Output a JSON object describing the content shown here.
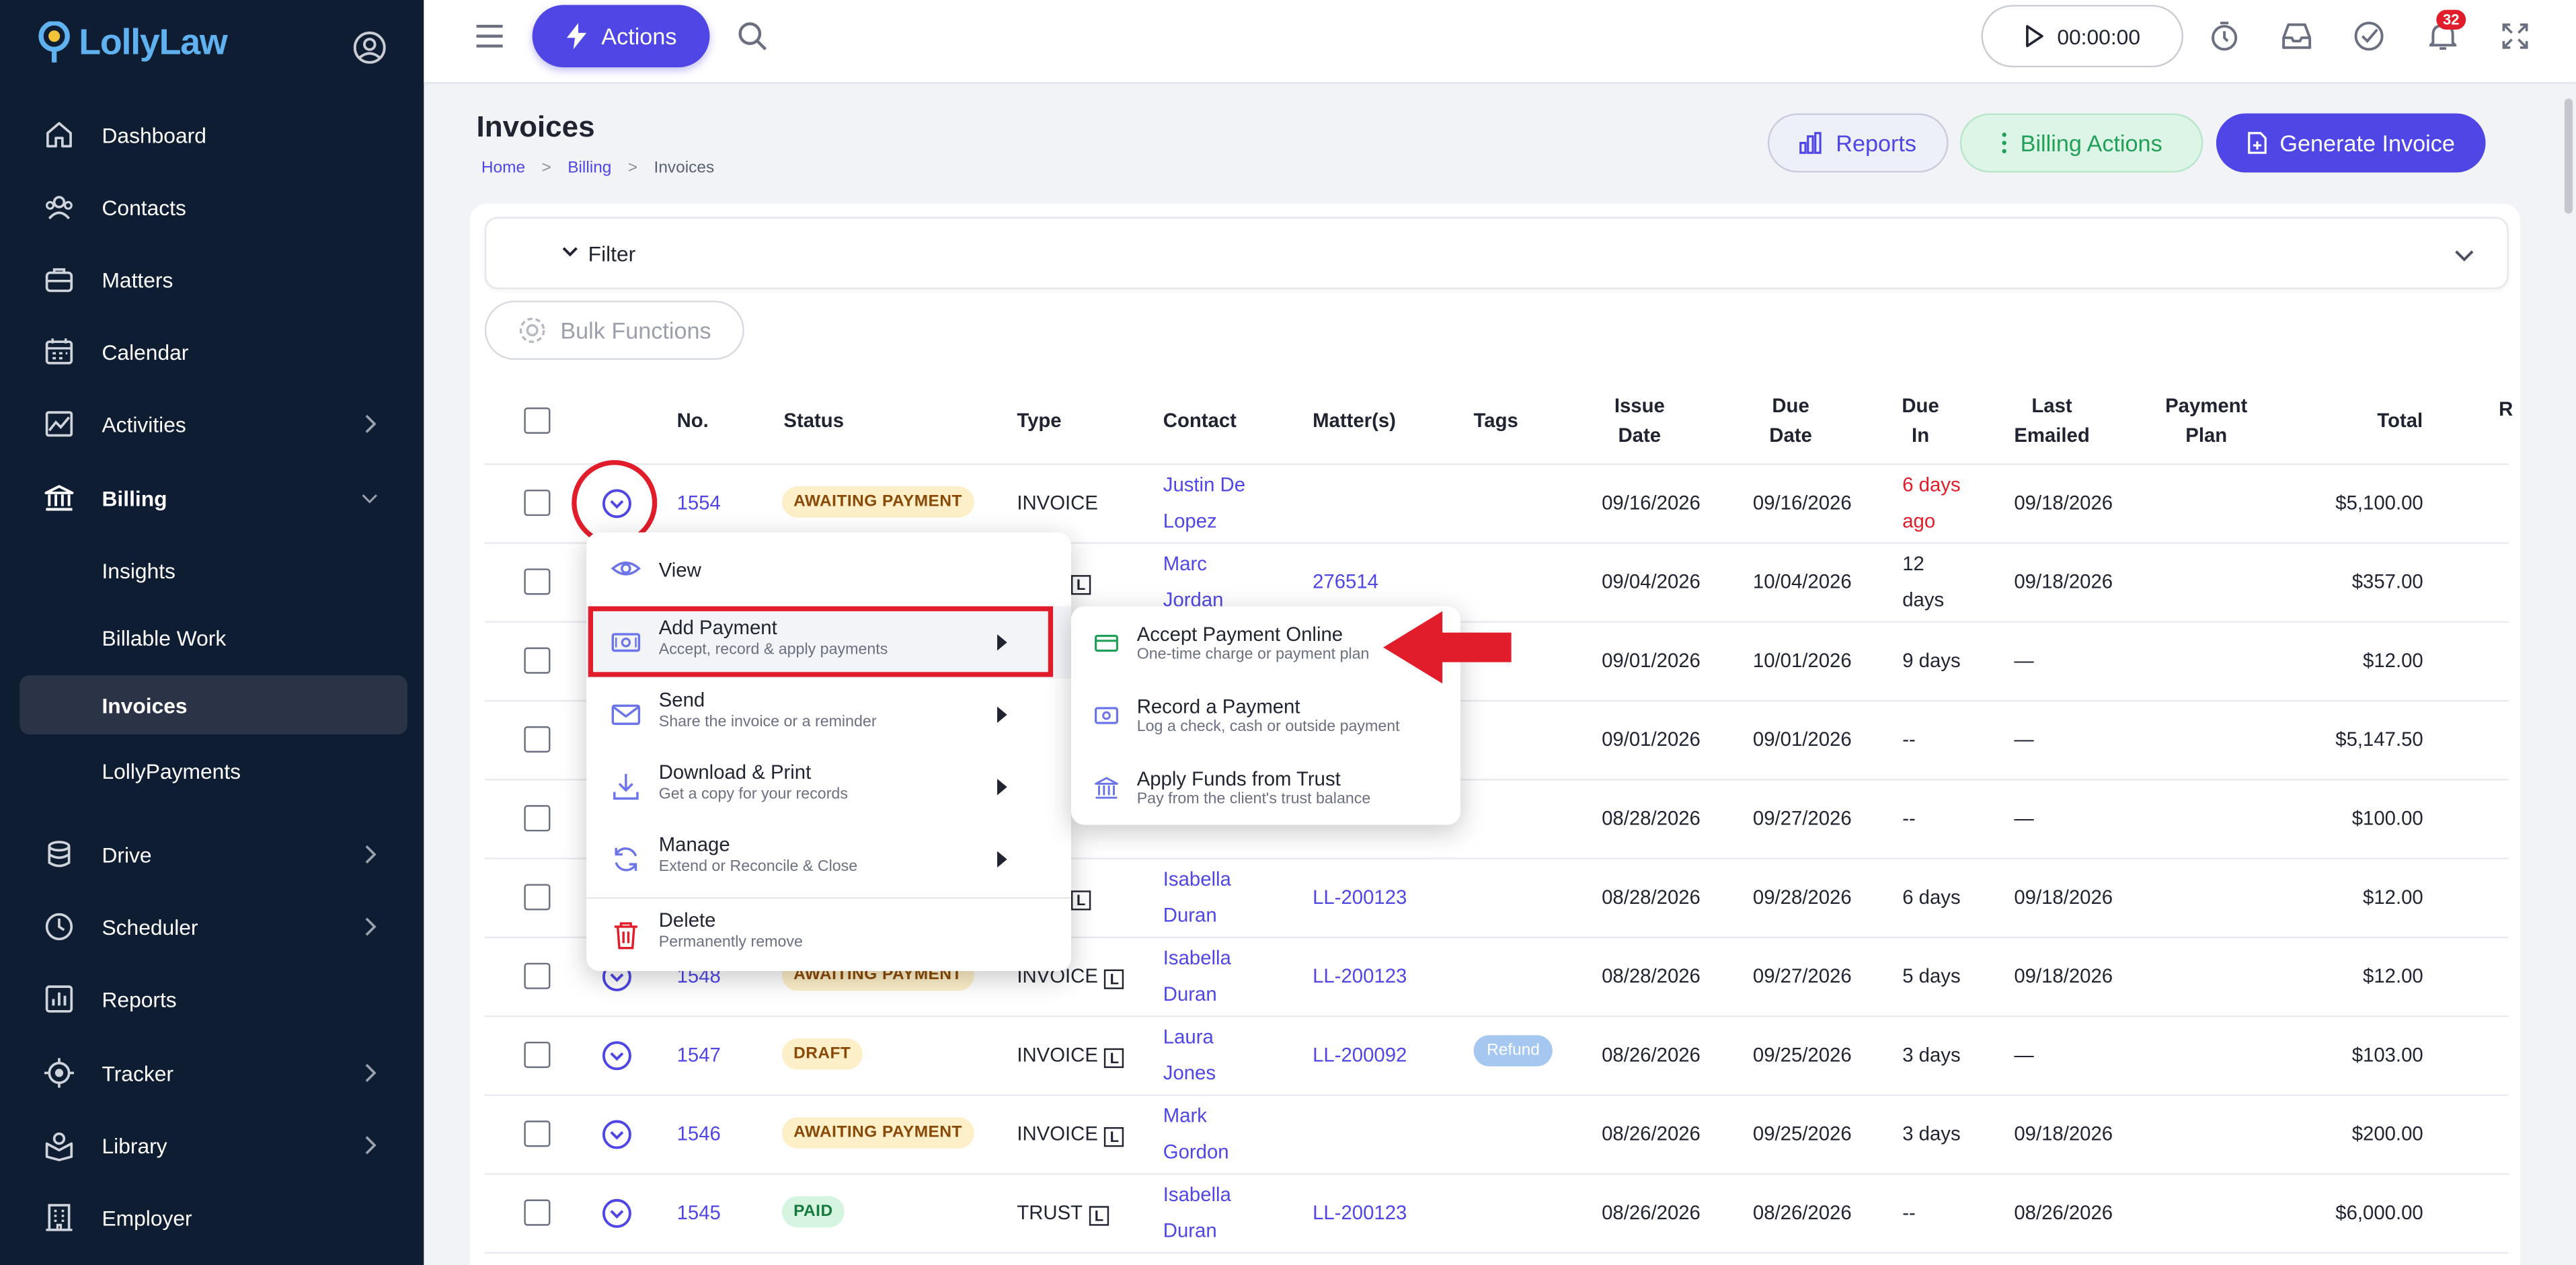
{
  "app": {
    "name": "LollyLaw"
  },
  "sidebar": {
    "items": [
      {
        "label": "Dashboard",
        "icon": "home-icon"
      },
      {
        "label": "Contacts",
        "icon": "contacts-icon"
      },
      {
        "label": "Matters",
        "icon": "briefcase-icon"
      },
      {
        "label": "Calendar",
        "icon": "calendar-icon"
      },
      {
        "label": "Activities",
        "icon": "activities-icon"
      },
      {
        "label": "Billing",
        "icon": "bank-icon"
      },
      {
        "label": "Drive",
        "icon": "database-icon"
      },
      {
        "label": "Scheduler",
        "icon": "clock-icon"
      },
      {
        "label": "Reports",
        "icon": "bar-chart-icon"
      },
      {
        "label": "Tracker",
        "icon": "target-icon"
      },
      {
        "label": "Library",
        "icon": "library-icon"
      },
      {
        "label": "Employer",
        "icon": "building-icon"
      }
    ],
    "billing_sub": [
      "Insights",
      "Billable Work",
      "Invoices",
      "LollyPayments"
    ]
  },
  "topbar": {
    "actions_label": "Actions",
    "timer": "00:00:00",
    "notifications_count": "32"
  },
  "page": {
    "title": "Invoices",
    "breadcrumb": [
      "Home",
      "Billing",
      "Invoices"
    ],
    "reports_label": "Reports",
    "billing_actions_label": "Billing Actions",
    "generate_label": "Generate Invoice",
    "filter_label": "Filter",
    "bulk_label": "Bulk Functions"
  },
  "table": {
    "headers": {
      "no": "No.",
      "status": "Status",
      "type": "Type",
      "contact": "Contact",
      "matters": "Matter(s)",
      "tags": "Tags",
      "issue_1": "Issue",
      "issue_2": "Date",
      "due_1": "Due",
      "due_2": "Date",
      "duein_1": "Due",
      "duein_2": "In",
      "emailed_1": "Last",
      "emailed_2": "Emailed",
      "plan_1": "Payment",
      "plan_2": "Plan",
      "total": "Total",
      "r": "R"
    },
    "rows": [
      {
        "no": "1554",
        "status": "AWAITING PAYMENT",
        "type": "INVOICE",
        "contact_1": "Justin De",
        "contact_2": "Lopez",
        "matter": "",
        "tag": "",
        "issue": "09/16/2026",
        "due": "09/16/2026",
        "duein_1": "6 days",
        "duein_2": "ago",
        "emailed": "09/18/2026",
        "total": "$5,100.00"
      },
      {
        "no": "",
        "status": "",
        "type": "ICE",
        "contact_1": "Marc",
        "contact_2": "Jordan",
        "matter": "276514",
        "tag": "",
        "issue": "09/04/2026",
        "due": "10/04/2026",
        "duein_1": "12",
        "duein_2": "days",
        "emailed": "09/18/2026",
        "total": "$357.00"
      },
      {
        "no": "",
        "status": "",
        "type": "",
        "contact_1": "",
        "contact_2": "",
        "matter": "",
        "tag": "",
        "issue": "09/01/2026",
        "due": "10/01/2026",
        "duein_1": "9 days",
        "duein_2": "",
        "emailed": "—",
        "total": "$12.00"
      },
      {
        "no": "",
        "status": "",
        "type": "",
        "contact_1": "",
        "contact_2": "",
        "matter": "",
        "tag": "",
        "issue": "09/01/2026",
        "due": "09/01/2026",
        "duein_1": "--",
        "duein_2": "",
        "emailed": "—",
        "total": "$5,147.50"
      },
      {
        "no": "",
        "status": "",
        "type": "",
        "contact_1": "",
        "contact_2": "",
        "matter": "",
        "tag": "",
        "issue": "08/28/2026",
        "due": "09/27/2026",
        "duein_1": "--",
        "duein_2": "",
        "emailed": "—",
        "total": "$100.00"
      },
      {
        "no": "",
        "status": "",
        "type": "ICE",
        "contact_1": "Isabella",
        "contact_2": "Duran",
        "matter": "LL-200123",
        "tag": "",
        "issue": "08/28/2026",
        "due": "09/28/2026",
        "duein_1": "6 days",
        "duein_2": "",
        "emailed": "09/18/2026",
        "total": "$12.00"
      },
      {
        "no": "1548",
        "status": "AWAITING PAYMENT",
        "type": "INVOICE",
        "contact_1": "Isabella",
        "contact_2": "Duran",
        "matter": "LL-200123",
        "tag": "",
        "issue": "08/28/2026",
        "due": "09/27/2026",
        "duein_1": "5 days",
        "duein_2": "",
        "emailed": "09/18/2026",
        "total": "$12.00"
      },
      {
        "no": "1547",
        "status": "DRAFT",
        "type": "INVOICE",
        "contact_1": "Laura",
        "contact_2": "Jones",
        "matter": "LL-200092",
        "tag": "Refund",
        "issue": "08/26/2026",
        "due": "09/25/2026",
        "duein_1": "3 days",
        "duein_2": "",
        "emailed": "—",
        "total": "$103.00"
      },
      {
        "no": "1546",
        "status": "AWAITING PAYMENT",
        "type": "INVOICE",
        "contact_1": "Mark",
        "contact_2": "Gordon",
        "matter": "",
        "tag": "",
        "issue": "08/26/2026",
        "due": "09/25/2026",
        "duein_1": "3 days",
        "duein_2": "",
        "emailed": "09/18/2026",
        "total": "$200.00"
      },
      {
        "no": "1545",
        "status": "PAID",
        "type": "TRUST",
        "contact_1": "Isabella",
        "contact_2": "Duran",
        "matter": "LL-200123",
        "tag": "",
        "issue": "08/26/2026",
        "due": "08/26/2026",
        "duein_1": "--",
        "duein_2": "",
        "emailed": "08/26/2026",
        "total": "$6,000.00"
      }
    ],
    "l_badge": "L"
  },
  "menu": {
    "items": [
      {
        "title": "View",
        "sub": ""
      },
      {
        "title": "Add Payment",
        "sub": "Accept, record & apply payments"
      },
      {
        "title": "Send",
        "sub": "Share the invoice or a reminder"
      },
      {
        "title": "Download & Print",
        "sub": "Get a copy for your records"
      },
      {
        "title": "Manage",
        "sub": "Extend or Reconcile & Close"
      },
      {
        "title": "Delete",
        "sub": "Permanently remove"
      }
    ]
  },
  "submenu": {
    "items": [
      {
        "title": "Accept Payment Online",
        "sub": "One-time charge or payment plan"
      },
      {
        "title": "Record a Payment",
        "sub": "Log a check, cash or outside payment"
      },
      {
        "title": "Apply Funds from Trust",
        "sub": "Pay from the client's trust balance"
      }
    ]
  },
  "colors": {
    "accent": "#4f46e5",
    "sidebar": "#0f1d33",
    "danger": "#e11d2b",
    "success": "#22a05a"
  }
}
